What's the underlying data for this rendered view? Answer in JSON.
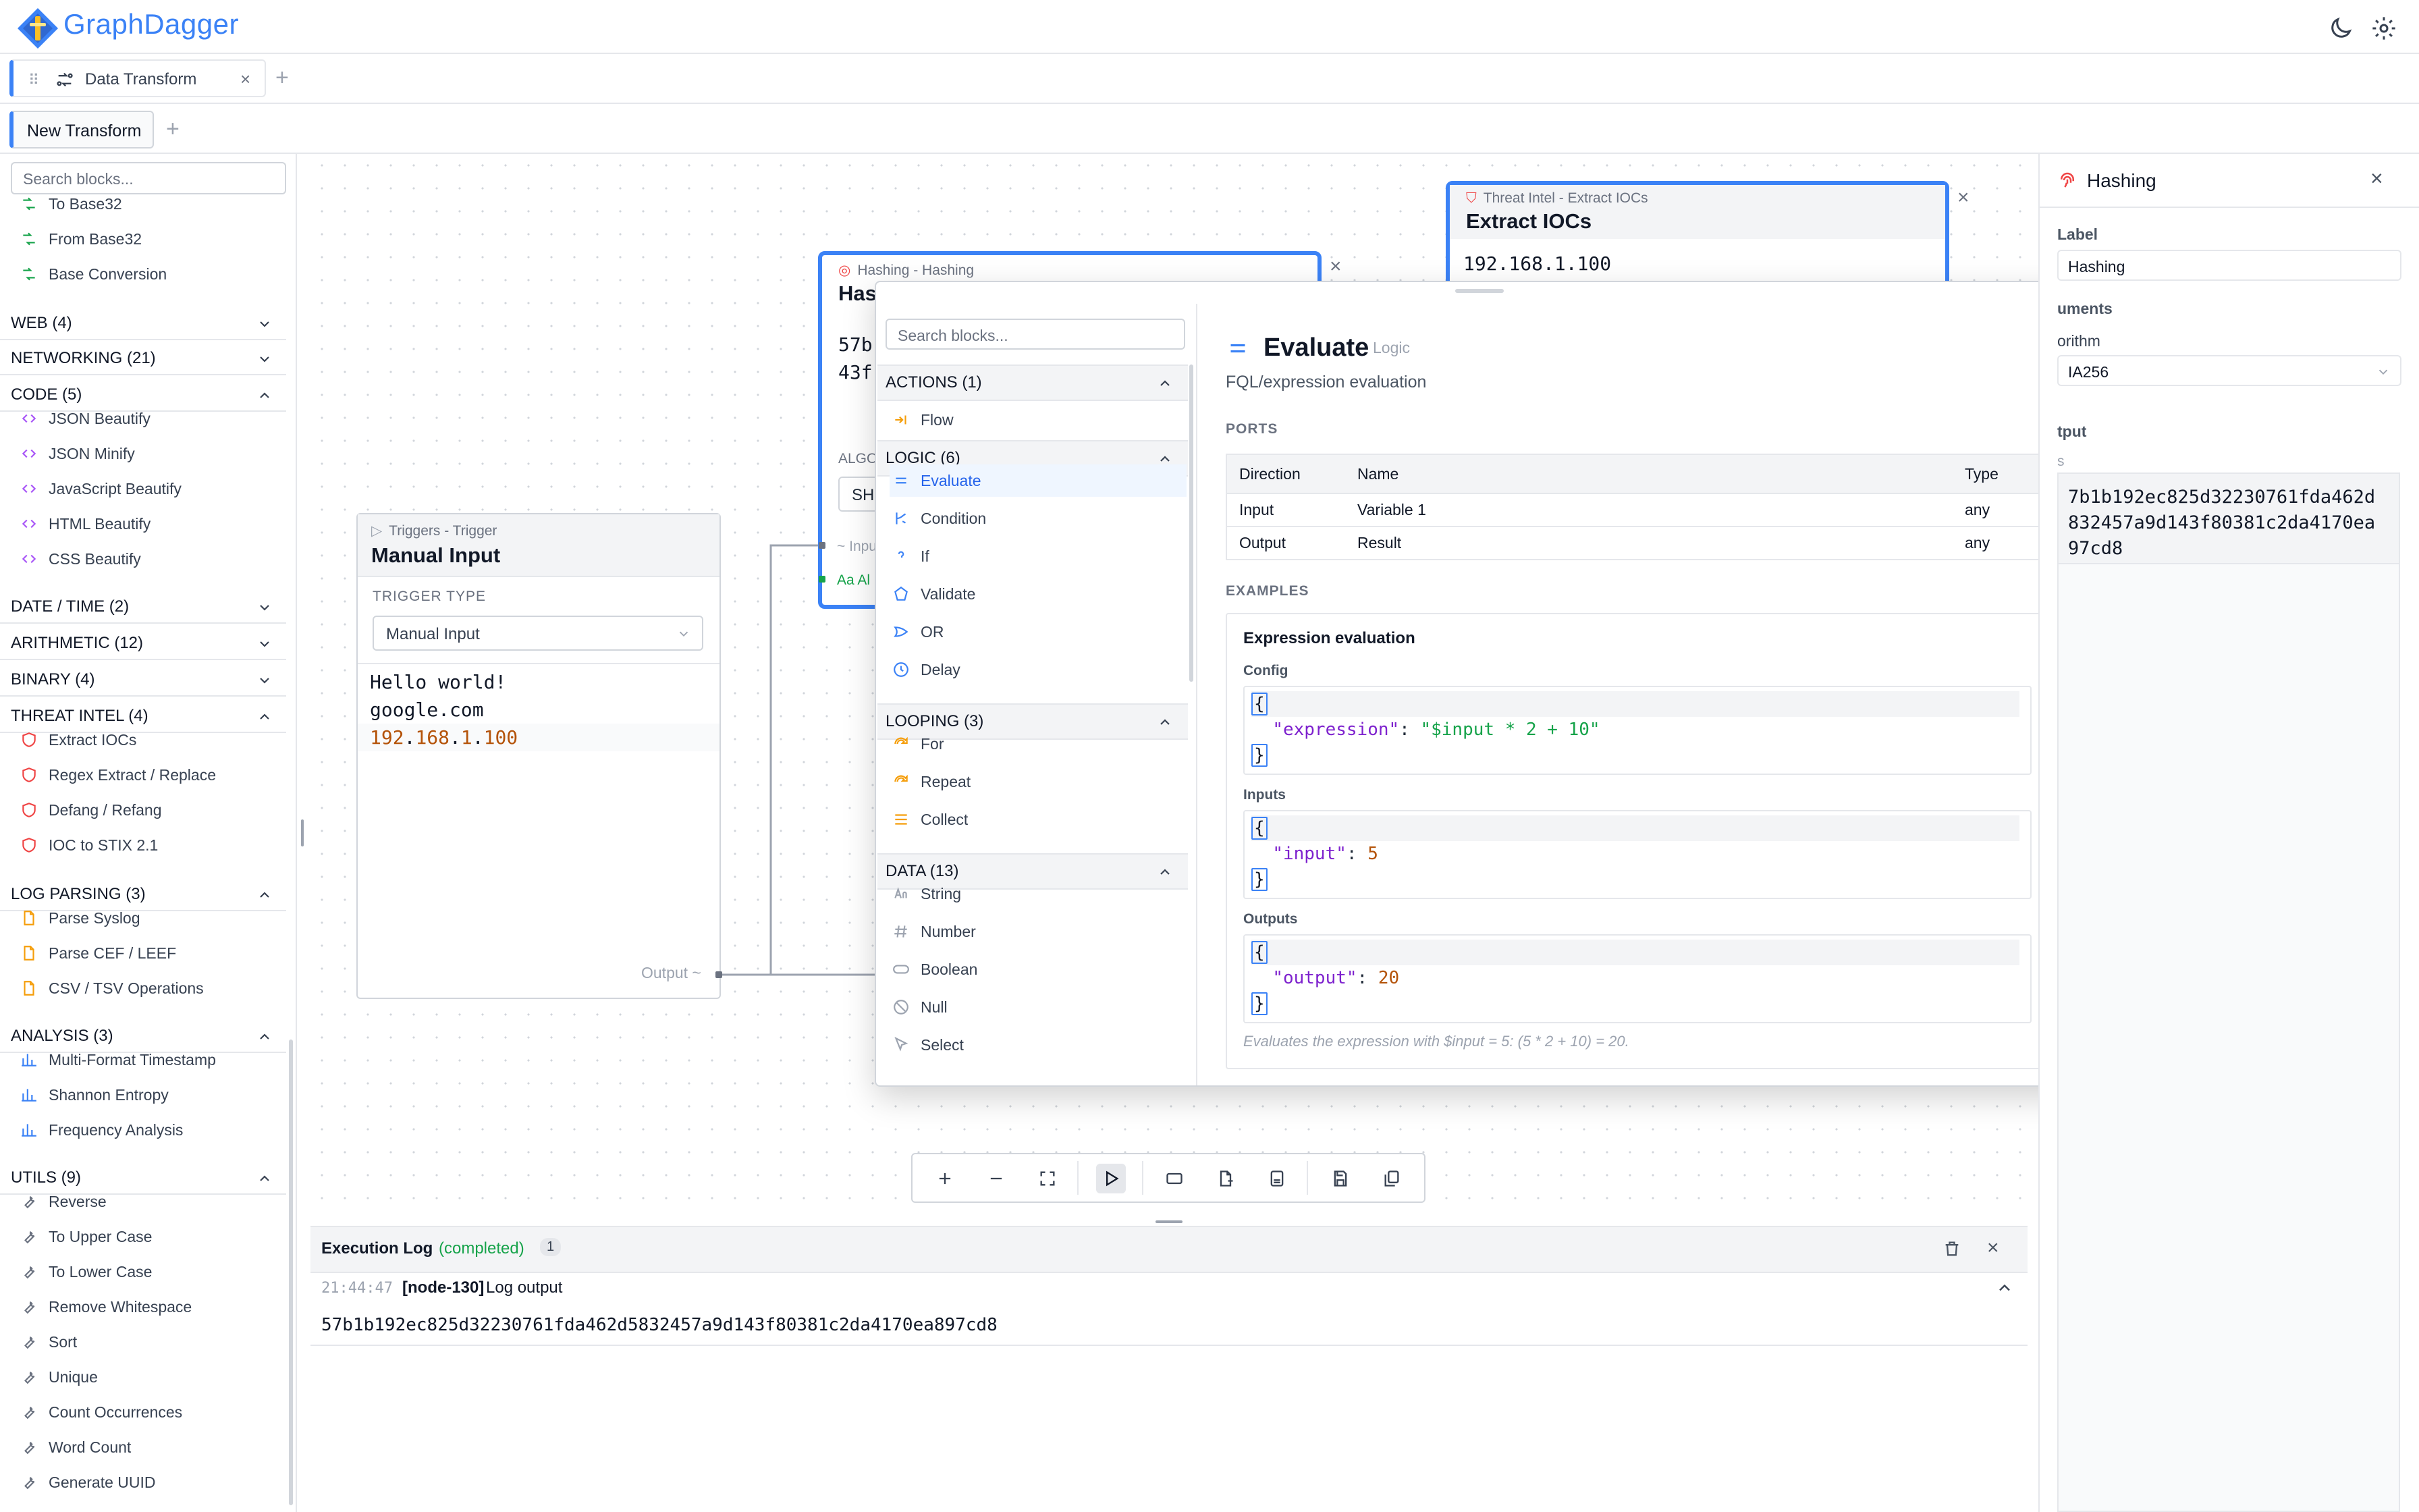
{
  "header": {
    "app_title": "GraphDagger"
  },
  "tabs": [
    {
      "label": "Data Transform"
    }
  ],
  "subtabs": [
    {
      "label": "New Transform"
    }
  ],
  "sidebar": {
    "search_placeholder": "Search blocks...",
    "top_items": [
      "To Base32",
      "From Base32",
      "Base Conversion"
    ],
    "categories": {
      "web": "WEB (4)",
      "networking": "NETWORKING (21)",
      "code": "CODE (5)",
      "datetime": "DATE / TIME (2)",
      "arithmetic": "ARITHMETIC (12)",
      "binary": "BINARY (4)",
      "threat": "THREAT INTEL (4)",
      "logparsing": "LOG PARSING (3)",
      "analysis": "ANALYSIS (3)",
      "utils": "UTILS (9)"
    },
    "code_items": [
      "JSON Beautify",
      "JSON Minify",
      "JavaScript Beautify",
      "HTML Beautify",
      "CSS Beautify"
    ],
    "threat_items": [
      "Extract IOCs",
      "Regex Extract / Replace",
      "Defang / Refang",
      "IOC to STIX 2.1"
    ],
    "log_items": [
      "Parse Syslog",
      "Parse CEF / LEEF",
      "CSV / TSV Operations"
    ],
    "analysis_items": [
      "Multi-Format Timestamp",
      "Shannon Entropy",
      "Frequency Analysis"
    ],
    "utils_items": [
      "Reverse",
      "To Upper Case",
      "To Lower Case",
      "Remove Whitespace",
      "Sort",
      "Unique",
      "Count Occurrences",
      "Word Count",
      "Generate UUID"
    ]
  },
  "nodes": {
    "trigger": {
      "subtitle": "Triggers - Trigger",
      "title": "Manual Input",
      "field_label": "TRIGGER TYPE",
      "field_value": "Manual Input",
      "lines": [
        "Hello world!",
        "google.com"
      ],
      "ip_parts": [
        "192",
        "168",
        "1",
        "100"
      ],
      "output_label": "Output"
    },
    "hashing": {
      "subtitle": "Hashing - Hashing",
      "title": "Has",
      "lines": [
        "57b",
        "43f"
      ],
      "algo_label": "ALGO",
      "algo_value": "SH",
      "input_label": "Input",
      "algo_port_label": "Al"
    },
    "iocs": {
      "subtitle": "Threat Intel - Extract IOCs",
      "title": "Extract IOCs",
      "value": "192.168.1.100"
    }
  },
  "popup": {
    "search_placeholder": "Search blocks...",
    "categories": {
      "actions": "ACTIONS (1)",
      "logic": "LOGIC (6)",
      "looping": "LOOPING (3)",
      "data": "DATA (13)"
    },
    "actions_items": [
      "Flow"
    ],
    "logic_items": [
      "Evaluate",
      "Condition",
      "If",
      "Validate",
      "OR",
      "Delay"
    ],
    "looping_items": [
      "For",
      "Repeat",
      "Collect"
    ],
    "data_items": [
      "String",
      "Number",
      "Boolean",
      "Null",
      "Select"
    ],
    "detail": {
      "title": "Evaluate",
      "badge": "Logic",
      "description": "FQL/expression evaluation",
      "ports_heading": "PORTS",
      "ports_headers": [
        "Direction",
        "Name",
        "Type"
      ],
      "ports_rows": [
        [
          "Input",
          "Variable 1",
          "any"
        ],
        [
          "Output",
          "Result",
          "any"
        ]
      ],
      "examples_heading": "EXAMPLES",
      "example_title": "Expression evaluation",
      "config_label": "Config",
      "inputs_label": "Inputs",
      "outputs_label": "Outputs",
      "config_key": "\"expression\"",
      "config_val": "\"$input * 2 + 10\"",
      "inputs_key": "\"input\"",
      "inputs_val": "5",
      "outputs_key": "\"output\"",
      "outputs_val": "20",
      "note": "Evaluates the expression with $input = 5: (5 * 2 + 10) = 20."
    }
  },
  "log": {
    "title": "Execution Log",
    "status": "(completed)",
    "count": "1",
    "time": "21:44:47",
    "node": "[node-130]",
    "message": "Log output",
    "output": "57b1b192ec825d32230761fda462d5832457a9d143f80381c2da4170ea897cd8"
  },
  "right_panel": {
    "title": "Hashing",
    "label_heading": "Label",
    "label_value": "Hashing",
    "arguments_heading": "uments",
    "algorithm_label": "orithm",
    "algorithm_value": "IA256",
    "output_heading": "tput",
    "output_sub": "s",
    "output_value": "57b1b192ec825d32230761fda462d5832457a9d143f80381c2da4170ea897cd8",
    "output_lines": [
      "7b1b192ec825d32230761fda462d",
      "832457a9d143f80381c2da4170ea",
      "97cd8"
    ]
  },
  "colors": {
    "accent": "#3b82f6",
    "success": "#16a34a",
    "threat": "#ef4444",
    "code": "#a855f7",
    "log": "#f59e0b",
    "utils": "#6b7280"
  }
}
